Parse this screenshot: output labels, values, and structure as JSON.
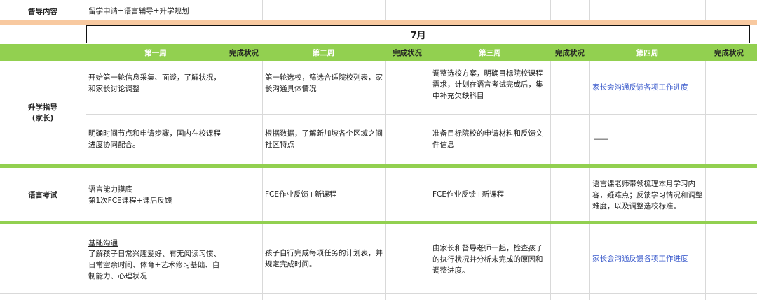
{
  "supervision": {
    "label": "督导内容",
    "value": "留学申请+语言辅导+升学规划"
  },
  "month": "7月",
  "week_headers": {
    "w1": "第一周",
    "s1": "完成状况",
    "w2": "第二周",
    "s2": "完成状况",
    "w3": "第三周",
    "s3": "完成状况",
    "w4": "第四周",
    "s4": "完成状况"
  },
  "sections": {
    "guidance": {
      "label": "升学指导\n(家长)",
      "r1": {
        "w1": "开始第一轮信息采集、面谈，了解状况，\n和家长讨论调整",
        "w2": "第一轮选校，筛选合适院校列表，家\n长沟通具体情况",
        "w3": "调整选校方案，明确目标院校课程\n需求，计划在语言考试完成后，集\n中补充欠缺科目",
        "w4": "家长会沟通反馈各项工作进度"
      },
      "r2": {
        "w1": "明确时间节点和申请步骤，国内在校课程\n进度协同配合。",
        "w2": "根据数据，了解新加坡各个区域之间\n社区特点",
        "w3": "准备目标院校的申请材料和反馈文\n件信息",
        "w4": "——"
      }
    },
    "language": {
      "label": "语言考试",
      "w1": "语言能力摸底\n第1次FCE课程+课后反馈",
      "w2": "FCE作业反馈+新课程",
      "w3": "FCE作业反馈+新课程",
      "w4": "语言课老师带领梳理本月学习内\n容，疑难点；反馈学习情况和调整\n难度，以及调整选校标准。"
    },
    "basic": {
      "w1_title": "基础沟通",
      "w1": "了解孩子日常兴趣爱好、有无阅读习惯、\n日常空余时间、体育+艺术修习基础、自\n制能力、心理状况",
      "w2": "孩子自行完成每项任务的计划表，并\n规定完成时间。",
      "w3": "由家长和督导老师一起，检查孩子\n的执行状况并分析未完成的原因和\n调整进度。",
      "w4": "家长会沟通反馈各项工作进度"
    }
  },
  "colors": {
    "green": "#92d050",
    "peach": "#f8c9a0",
    "link": "#3b5bcc"
  }
}
